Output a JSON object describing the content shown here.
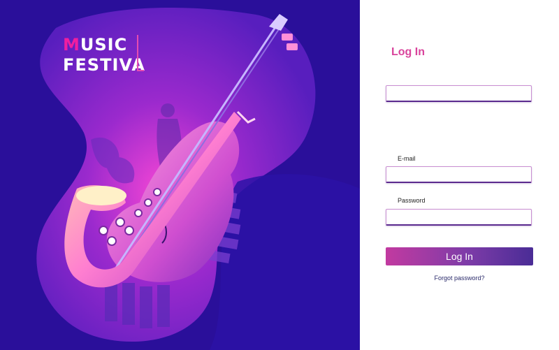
{
  "brand": {
    "line1_first": "M",
    "line1_rest": "USIC",
    "line2": "FESTIVA"
  },
  "login": {
    "title": "Log In",
    "top_field": {
      "value": "",
      "placeholder": ""
    },
    "email": {
      "label": "E-mail",
      "value": "",
      "placeholder": ""
    },
    "password": {
      "label": "Password",
      "value": "",
      "placeholder": ""
    },
    "button_label": "Log In",
    "forgot_label": "Forgot password?"
  },
  "colors": {
    "background_dark": "#2a0f9a",
    "accent_pink": "#d9449c",
    "button_gradient_start": "#c23aa0",
    "button_gradient_end": "#4a2c96"
  },
  "illustration": {
    "icons": [
      "saxophone-icon",
      "violin-icon",
      "piano-keys-icon",
      "leaf-icon",
      "singer-silhouette-icon"
    ]
  }
}
